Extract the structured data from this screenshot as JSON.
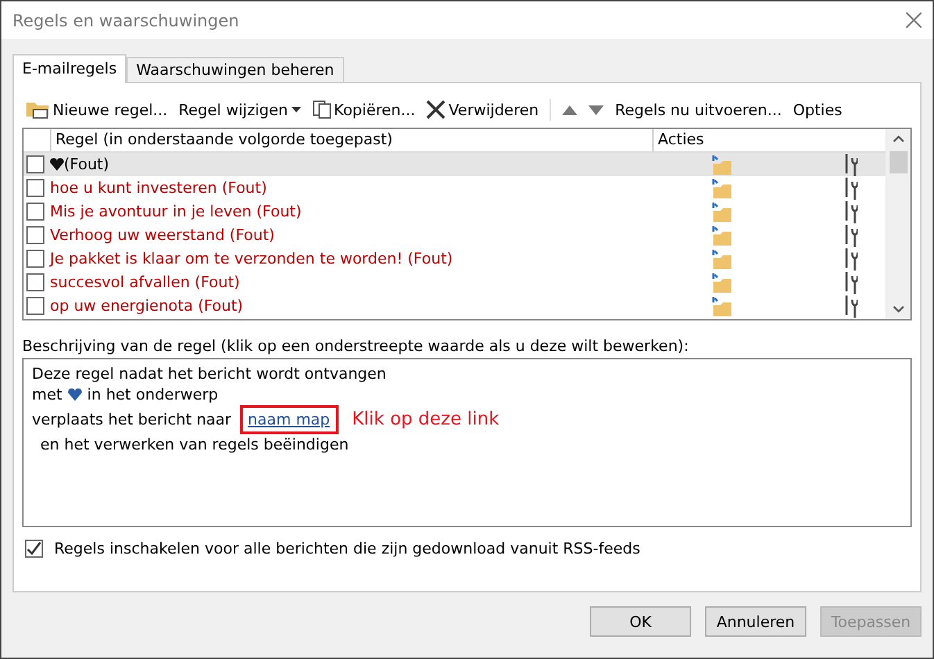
{
  "window": {
    "title": "Regels en waarschuwingen"
  },
  "tabs": [
    {
      "label": "E-mailregels",
      "selected": true
    },
    {
      "label": "Waarschuwingen beheren",
      "selected": false
    }
  ],
  "toolbar": [
    {
      "kind": "new",
      "label": "Nieuwe regel..."
    },
    {
      "kind": "menu",
      "label": "Regel wijzigen"
    },
    {
      "kind": "copy",
      "label": "Kopiëren..."
    },
    {
      "kind": "delete",
      "label": "Verwijderen"
    },
    {
      "kind": "up"
    },
    {
      "kind": "down"
    },
    {
      "kind": "text",
      "label": "Regels nu uitvoeren..."
    },
    {
      "kind": "text",
      "label": "Opties"
    }
  ],
  "table": {
    "columns": [
      "Regel (in onderstaande volgorde toegepast)",
      "Acties"
    ],
    "rows": [
      {
        "name": "(Fout)",
        "has_icon": true,
        "checked": false,
        "selected": true,
        "error": false
      },
      {
        "name": "hoe u kunt investeren  (Fout)",
        "has_icon": false,
        "checked": false,
        "selected": false,
        "error": true
      },
      {
        "name": "Mis je avontuur in je leven  (Fout)",
        "has_icon": false,
        "checked": false,
        "selected": false,
        "error": true
      },
      {
        "name": "Verhoog uw weerstand  (Fout)",
        "has_icon": false,
        "checked": false,
        "selected": false,
        "error": true
      },
      {
        "name": "Je pakket is klaar om te verzonden te worden!  (Fout)",
        "has_icon": false,
        "checked": false,
        "selected": false,
        "error": true
      },
      {
        "name": "succesvol afvallen  (Fout)",
        "has_icon": false,
        "checked": false,
        "selected": false,
        "error": true
      },
      {
        "name": "op uw energienota  (Fout)",
        "has_icon": false,
        "checked": false,
        "selected": false,
        "error": true
      }
    ]
  },
  "description": {
    "label": "Beschrijving van de regel (klik op een onderstreepte waarde als u deze wilt bewerken):",
    "line_1": "Deze regel nadat het bericht wordt ontvangen",
    "subject_prefix": "met",
    "subject_suffix": "in het onderwerp",
    "move_text": "verplaats het bericht naar",
    "folder_link": "naam map",
    "stop_text": "en het verwerken van regels beëindigen"
  },
  "annotation": {
    "label": "Klik op deze link"
  },
  "rss": {
    "label": "Regels inschakelen voor alle berichten die zijn gedownload vanuit RSS-feeds",
    "checked": true
  },
  "buttons": [
    {
      "label": "OK",
      "disabled": false
    },
    {
      "label": "Annuleren",
      "disabled": false
    },
    {
      "label": "Toepassen",
      "disabled": true
    }
  ]
}
